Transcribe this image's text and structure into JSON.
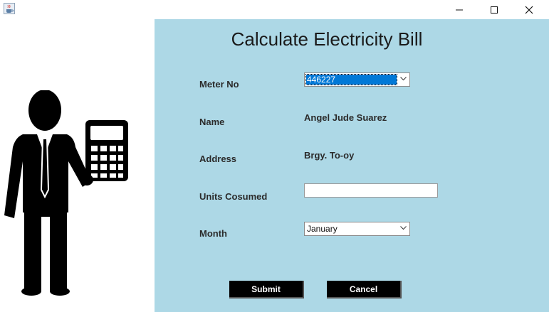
{
  "window": {
    "icon": "java-cup-icon",
    "controls": [
      "minimize-icon",
      "maximize-icon",
      "close-icon"
    ]
  },
  "illustration": {
    "icon": "man-with-calculator-icon"
  },
  "form": {
    "title": "Calculate Electricity Bill",
    "meter_no": {
      "label": "Meter No",
      "selected": "446227"
    },
    "name": {
      "label": "Name",
      "value": "Angel Jude Suarez"
    },
    "address": {
      "label": "Address",
      "value": "Brgy. To-oy"
    },
    "units": {
      "label": "Units Cosumed",
      "value": ""
    },
    "month": {
      "label": "Month",
      "selected": "January"
    },
    "submit_label": "Submit",
    "cancel_label": "Cancel"
  },
  "colors": {
    "form_background": "#add8e6",
    "button_background": "#000000",
    "selection": "#0078d7"
  }
}
